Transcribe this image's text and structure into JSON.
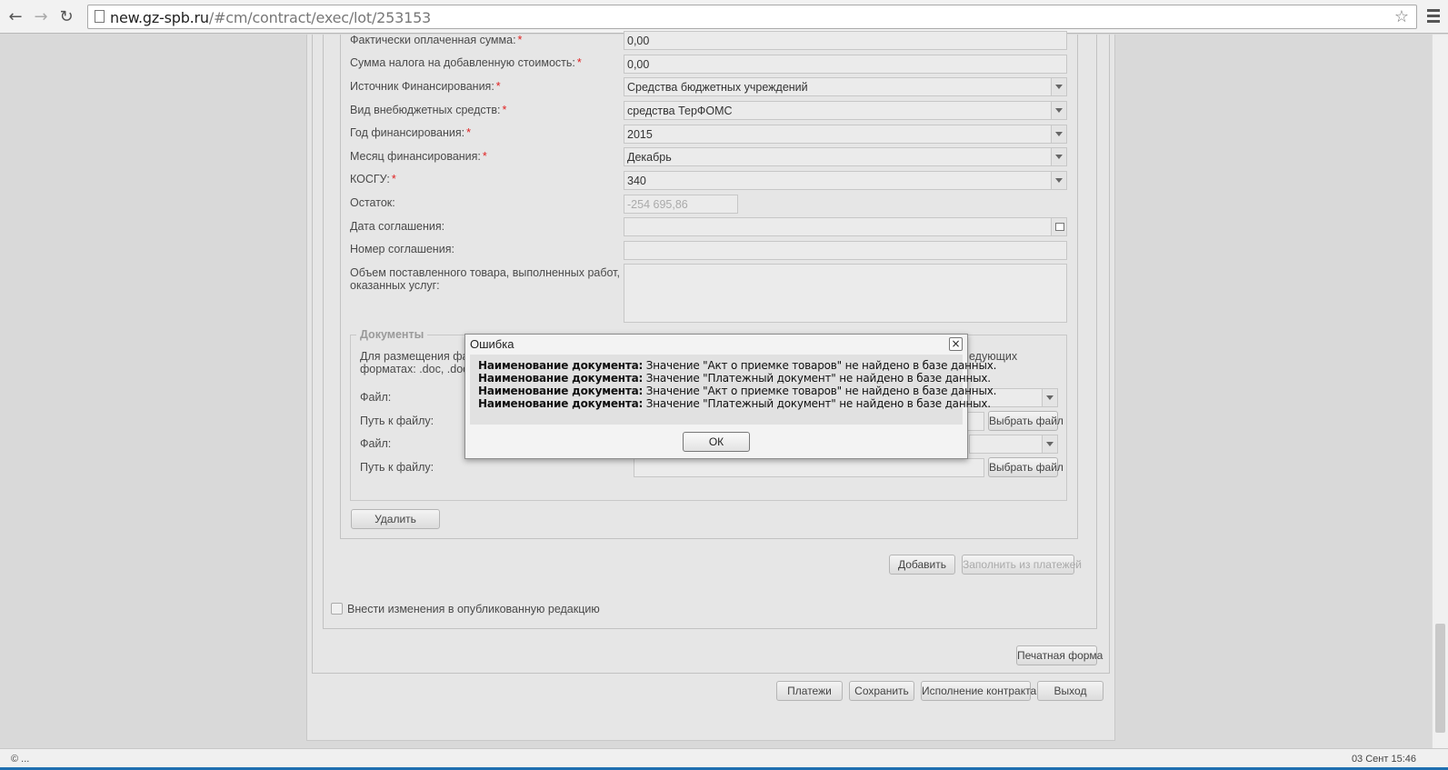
{
  "browser": {
    "url_host": "new.gz-spb.ru",
    "url_path": "/#cm/contract/exec/lot/253153"
  },
  "form": {
    "fields": [
      {
        "label": "Фактически оплаченная сумма:",
        "value": "0,00"
      },
      {
        "label": "Сумма налога на добавленную стоимость:",
        "value": "0,00"
      },
      {
        "label": "Источник Финансирования:",
        "value": "Средства бюджетных учреждений"
      },
      {
        "label": "Вид внебюджетных средств:",
        "value": "средства ТерФОМС"
      },
      {
        "label": "Год финансирования:",
        "value": "2015"
      },
      {
        "label": "Месяц финансирования:",
        "value": "Декабрь"
      },
      {
        "label": "КОСГУ:",
        "value": "340"
      },
      {
        "label": "Остаток:",
        "value": "-254 695,86"
      },
      {
        "label": "Дата соглашения:",
        "value": ""
      },
      {
        "label": "Номер соглашения:",
        "value": ""
      },
      {
        "label": "Объем поставленного товара, выполненных работ,",
        "label2": "оказанных услуг:",
        "value": ""
      }
    ],
    "required_mark": "*"
  },
  "documents": {
    "legend": "Документы",
    "info_line1": "Для размещения фа",
    "info_line1_end": "едующих",
    "info_line2": "форматах: .doc, .doc",
    "file_label": "Файл:",
    "path_label": "Путь к файлу:",
    "choose_file": "Выбрать файл",
    "delete_button": "Удалить"
  },
  "actions": {
    "add": "Добавить",
    "fill_from_payments": "Заполнить из платежей",
    "publish_changes_label": "Внести изменения в опубликованную редакцию",
    "print_form": "Печатная форма",
    "payments": "Платежи",
    "save": "Сохранить",
    "contract_execution": "Исполнение контракта",
    "exit": "Выход"
  },
  "dialog": {
    "title": "Ошибка",
    "close": "×",
    "messages": [
      {
        "bold": "Наименование документа:",
        "text": " Значение \"Акт о приемке товаров\" не найдено в базе данных."
      },
      {
        "bold": "Наименование документа:",
        "text": " Значение \"Платежный документ\" не найдено в базе данных."
      },
      {
        "bold": "Наименование документа:",
        "text": " Значение \"Акт о приемке товаров\" не найдено в базе данных."
      },
      {
        "bold": "Наименование документа:",
        "text": " Значение \"Платежный документ\" не найдено в базе данных."
      }
    ],
    "ok": "ОК"
  },
  "status": {
    "left": "© ...",
    "right": "03 Сент 15:46"
  },
  "colors": {
    "required": "#e02020",
    "page_bg": "#d9d9d9",
    "status_strip": "#1f6fb0"
  }
}
